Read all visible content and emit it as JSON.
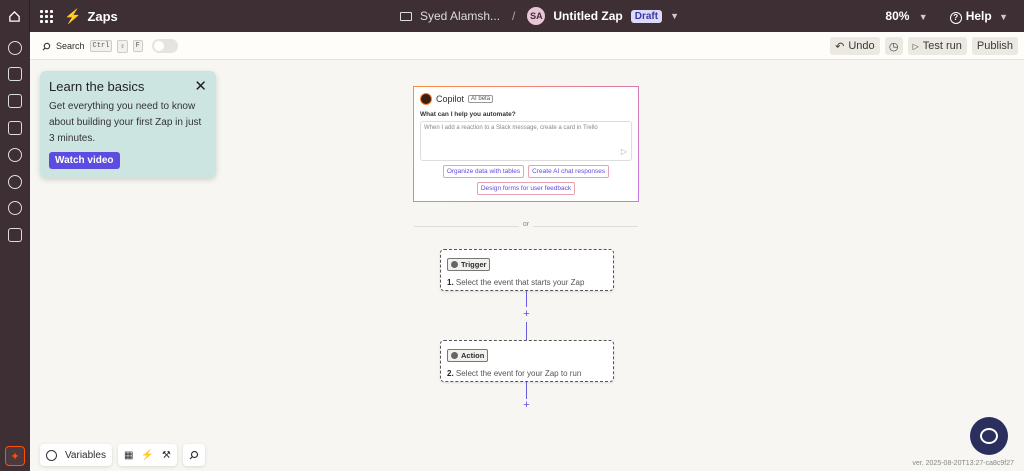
{
  "header": {
    "app_title": "Zaps",
    "folder_name": "Syed Alamsh...",
    "separator": "/",
    "avatar_initials": "SA",
    "zap_name": "Untitled Zap",
    "status_badge": "Draft",
    "zoom": "80%",
    "help_label": "Help"
  },
  "toolbar": {
    "search_label": "Search",
    "shortcut_keys": [
      "Ctrl",
      "⇧",
      "F"
    ],
    "undo_label": "Undo",
    "test_run_label": "Test run",
    "publish_label": "Publish"
  },
  "learn_card": {
    "title": "Learn the basics",
    "body": "Get everything you need to know about building your first Zap in just 3 minutes.",
    "button_label": "Watch video"
  },
  "copilot": {
    "title": "Copilot",
    "badge": "AI beta",
    "question": "What can I help you automate?",
    "placeholder": "When I add a reaction to a Slack message, create a card in Trello",
    "suggestions": [
      "Organize data with tables",
      "Create AI chat responses",
      "Design forms for user feedback"
    ]
  },
  "divider_text": "or",
  "steps": [
    {
      "chip": "Trigger",
      "number": "1.",
      "description": "Select the event that starts your Zap"
    },
    {
      "chip": "Action",
      "number": "2.",
      "description": "Select the event for your Zap to run"
    }
  ],
  "add_step_symbol": "+",
  "bottom_bar": {
    "variables_label": "Variables"
  },
  "version": "ver. 2025-08-20T13:27-ca8c9f27",
  "colors": {
    "topbar": "#3d2f33",
    "accent": "#5d4ce0",
    "brand_orange": "#ff4f00"
  }
}
